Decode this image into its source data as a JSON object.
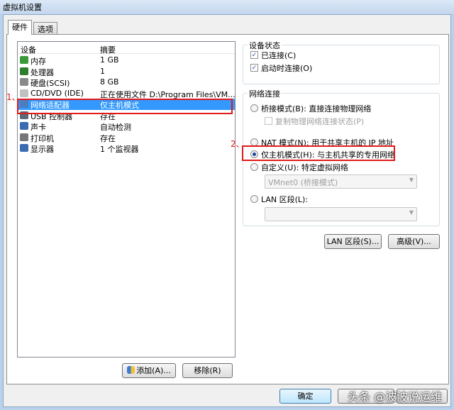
{
  "window": {
    "title": "虚拟机设置"
  },
  "tabs": [
    {
      "label": "硬件"
    },
    {
      "label": "选项"
    }
  ],
  "device_list": {
    "headers": [
      "设备",
      "摘要"
    ],
    "rows": [
      {
        "device": "内存",
        "summary": "1 GB",
        "icon": "memory-icon"
      },
      {
        "device": "处理器",
        "summary": "1",
        "icon": "processor-icon"
      },
      {
        "device": "硬盘(SCSI)",
        "summary": "8 GB",
        "icon": "hard-disk-icon"
      },
      {
        "device": "CD/DVD (IDE)",
        "summary": "正在使用文件 D:\\Program Files\\VM...",
        "icon": "cd-dvd-icon"
      },
      {
        "device": "网络适配器",
        "summary": "仅主机模式",
        "icon": "network-adapter-icon",
        "selected": true
      },
      {
        "device": "USB 控制器",
        "summary": "存在",
        "icon": "usb-icon"
      },
      {
        "device": "声卡",
        "summary": "自动检测",
        "icon": "sound-card-icon"
      },
      {
        "device": "打印机",
        "summary": "存在",
        "icon": "printer-icon"
      },
      {
        "device": "显示器",
        "summary": "1 个监视器",
        "icon": "display-icon"
      }
    ],
    "add_button": "添加(A)...",
    "remove_button": "移除(R)"
  },
  "annotations": [
    "1、",
    "2、"
  ],
  "device_status": {
    "title": "设备状态",
    "connected": {
      "label": "已连接(C)",
      "checked": true
    },
    "connect_at_power_on": {
      "label": "启动时连接(O)",
      "checked": true
    }
  },
  "network": {
    "title": "网络连接",
    "bridged": {
      "label": "桥接模式(B): 直接连接物理网络",
      "selected": false
    },
    "replicate": {
      "label": "复制物理网络连接状态(P)",
      "checked": false
    },
    "nat": {
      "label": "NAT 模式(N): 用于共享主机的 IP 地址",
      "selected": false
    },
    "host_only": {
      "label": "仅主机模式(H): 与主机共享的专用网络",
      "selected": true
    },
    "custom": {
      "label": "自定义(U): 特定虚拟网络",
      "selected": false
    },
    "custom_value": "VMnet0 (桥接模式)",
    "lan": {
      "label": "LAN 区段(L):",
      "selected": false
    },
    "lan_value": "",
    "lan_segments_button": "LAN 区段(S)...",
    "advanced_button": "高级(V)..."
  },
  "footer": {
    "ok_button": "确定",
    "watermark": "头条 @波波说运维"
  },
  "colors": {
    "selection": "#3399ff",
    "highlight_box": "#e21a1a"
  }
}
